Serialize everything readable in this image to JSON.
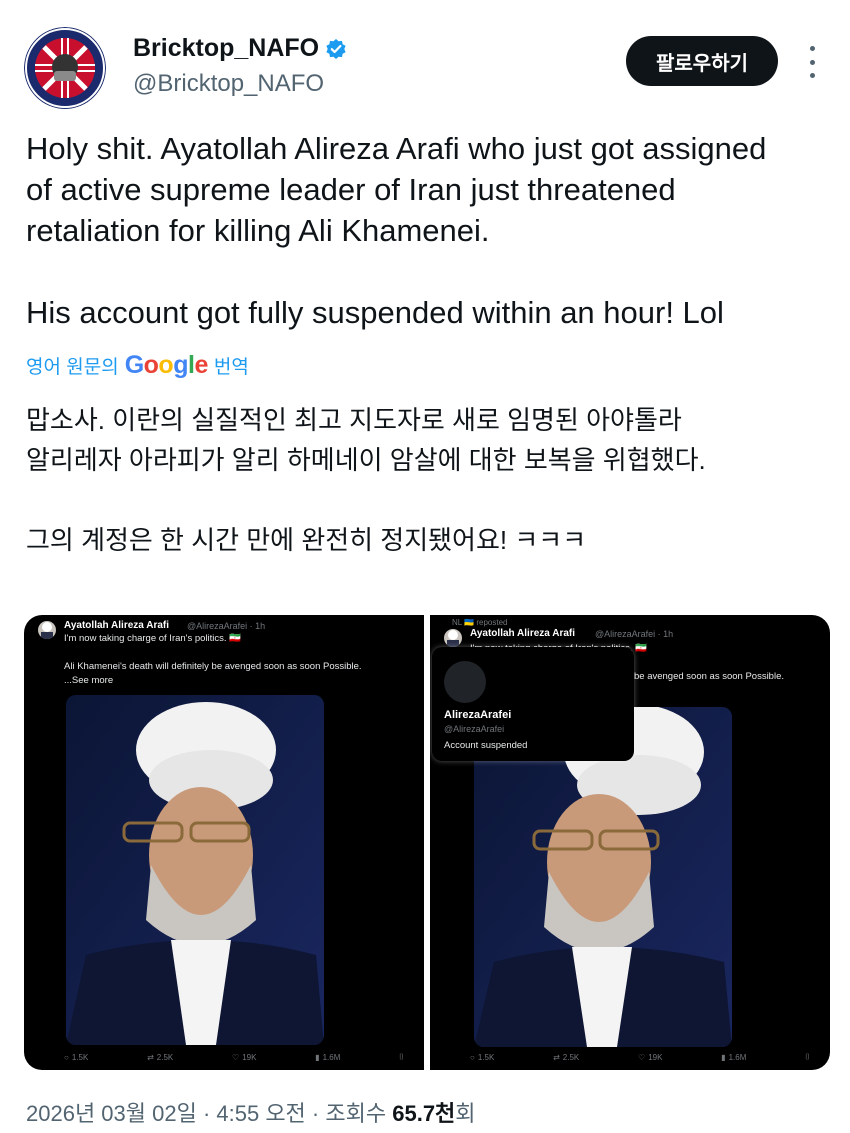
{
  "author": {
    "display_name": "Bricktop_NAFO",
    "handle": "@Bricktop_NAFO",
    "avatar_text_top": "NAFO OPAN",
    "avatar_text_bottom": "MAIN BASTARDS"
  },
  "follow_label": "팔로우하기",
  "tweet": {
    "lines": [
      "Holy shit. Ayatollah Alireza Arafi who just got assigned",
      "of active supreme leader of Iran just threatened",
      "retaliation for killing Ali Khamenei."
    ],
    "second_paragraph": "His account got fully suspended within an hour! Lol"
  },
  "translate": {
    "prefix": "영어 원문의",
    "google": "Google",
    "suffix": "번역"
  },
  "translation": {
    "lines": [
      "맙소사. 이란의 실질적인 최고 지도자로 새로 임명된 아야톨라",
      "알리레자 아라피가 알리 하메네이 암살에 대한 보복을 위협했다."
    ],
    "second_paragraph": "그의 계정은 한 시간 만에 완전히 정지됐어요! ㅋㅋㅋ"
  },
  "media": {
    "left": {
      "name": "Ayatollah Alireza Arafi",
      "handle": "@AlirezaArafei · 1h",
      "line1": "I'm now taking charge of Iran's politics. 🇮🇷",
      "line2": "Ali Khamenei's death will definitely be avenged soon as soon Possible.",
      "see_more": "...See more",
      "stats": [
        "1.5K",
        "2.5K",
        "19K",
        "1.6M"
      ]
    },
    "right": {
      "repost_line": "NL 🇺🇦 reposted",
      "name": "Ayatollah Alireza Arafi",
      "handle": "@AlirezaArafei · 1h",
      "line1": "I'm now taking charge of Iran's politics. 🇮🇷",
      "line2_visible": "be avenged soon as soon Possible.",
      "popup": {
        "name": "AlirezaArafei",
        "handle": "@AlirezaArafei",
        "status": "Account suspended"
      },
      "stats": [
        "1.5K",
        "2.5K",
        "19K",
        "1.6M"
      ]
    }
  },
  "footer": {
    "date": "2026년 03월 02일",
    "time": "4:55 오전",
    "views_label": "조회수",
    "views_value": "65.7천",
    "views_suffix": "회"
  },
  "colors": {
    "link": "#1d9bf0",
    "verified": "#1d9bf0",
    "button_bg": "#0f1419",
    "secondary_text": "#536471"
  }
}
